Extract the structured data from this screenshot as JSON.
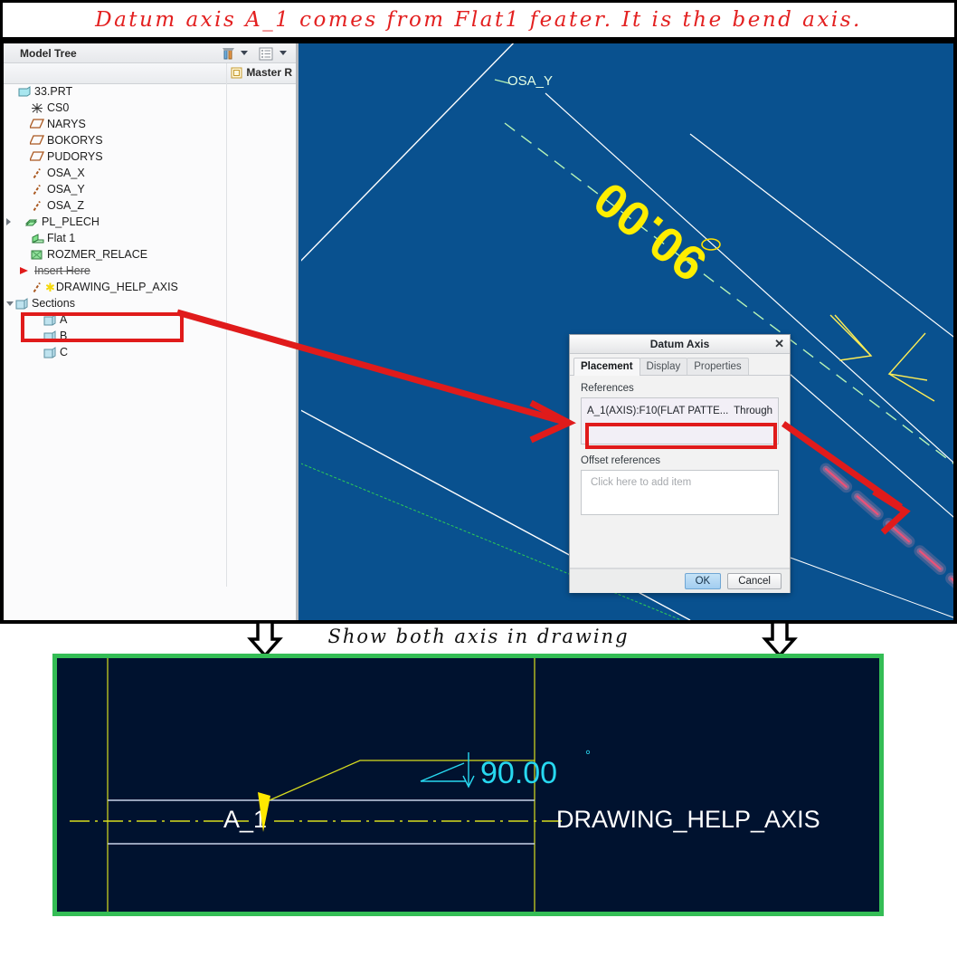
{
  "banner": {
    "text": "Datum axis A_1 comes from Flat1 feater. It is the bend axis."
  },
  "model_tree": {
    "title": "Model Tree",
    "column_header": "Master R",
    "toolbar": [
      {
        "name": "filter-icon",
        "label": "filter"
      },
      {
        "name": "tree-columns-icon",
        "label": "columns"
      }
    ],
    "items": [
      {
        "label": "33.PRT",
        "icon": "part-icon",
        "indent": 0,
        "expander": "none"
      },
      {
        "label": "CS0",
        "icon": "coord-sys-icon",
        "indent": 1,
        "expander": "none"
      },
      {
        "label": "NARYS",
        "icon": "datum-plane-icon",
        "indent": 1,
        "expander": "none"
      },
      {
        "label": "BOKORYS",
        "icon": "datum-plane-icon",
        "indent": 1,
        "expander": "none"
      },
      {
        "label": "PUDORYS",
        "icon": "datum-plane-icon",
        "indent": 1,
        "expander": "none"
      },
      {
        "label": "OSA_X",
        "icon": "datum-axis-icon",
        "indent": 1,
        "expander": "none"
      },
      {
        "label": "OSA_Y",
        "icon": "datum-axis-icon",
        "indent": 1,
        "expander": "none"
      },
      {
        "label": "OSA_Z",
        "icon": "datum-axis-icon",
        "indent": 1,
        "expander": "none"
      },
      {
        "label": "PL_PLECH",
        "icon": "sheetmetal-icon",
        "indent": 1,
        "expander": "collapsed"
      },
      {
        "label": "Flat 1",
        "icon": "flat-pattern-icon",
        "indent": 1,
        "expander": "none"
      },
      {
        "label": "ROZMER_RELACE",
        "icon": "relations-icon",
        "indent": 1,
        "expander": "none"
      },
      {
        "label": "Insert Here",
        "icon": "insert-here-icon",
        "indent": 1,
        "expander": "none",
        "strikethrough": true
      },
      {
        "label": "DRAWING_HELP_AXIS",
        "icon": "datum-axis-new-icon",
        "indent": 1,
        "expander": "none",
        "highlighted": true
      },
      {
        "label": "Sections",
        "icon": "sections-icon",
        "indent": 0,
        "expander": "open"
      },
      {
        "label": "A",
        "icon": "section-icon",
        "indent": 2,
        "expander": "none"
      },
      {
        "label": "B",
        "icon": "section-icon",
        "indent": 2,
        "expander": "none"
      },
      {
        "label": "C",
        "icon": "section-icon",
        "indent": 2,
        "expander": "none"
      }
    ]
  },
  "viewport": {
    "background_color": "#09518f",
    "labels": [
      {
        "name": "osa-y-axis-label",
        "text": "OSA_Y",
        "color": "#d9ffd9"
      }
    ],
    "dimension": {
      "text": "90.00",
      "color": "#ffff00",
      "rotated": true
    }
  },
  "dialog": {
    "title": "Datum Axis",
    "close_label": "✕",
    "tabs": [
      {
        "label": "Placement",
        "active": true
      },
      {
        "label": "Display",
        "active": false
      },
      {
        "label": "Properties",
        "active": false
      }
    ],
    "references_label": "References",
    "reference_row": {
      "name": "A_1(AXIS):F10(FLAT PATTE...",
      "constraint": "Through"
    },
    "offset_references_label": "Offset references",
    "offset_placeholder": "Click here to add item",
    "buttons": {
      "ok": "OK",
      "cancel": "Cancel"
    },
    "accent_color": "#a2cdf0"
  },
  "annotations": {
    "highlight_color": "#e01b1b",
    "arrow_color": "#e01b1b",
    "mid_caption": "Show both axis in drawing",
    "down_arrow_count": 2
  },
  "drawing": {
    "border_color": "#34bd55",
    "background_color": "#00122f",
    "axis_label_left": "A_1",
    "axis_label_right": "DRAWING_HELP_AXIS",
    "angle_dimension": "90.00",
    "angle_unit": "°",
    "dimension_color": "#27d8f0",
    "axis_color": "#d9d94a",
    "outline_color": "#c8d2e8"
  }
}
